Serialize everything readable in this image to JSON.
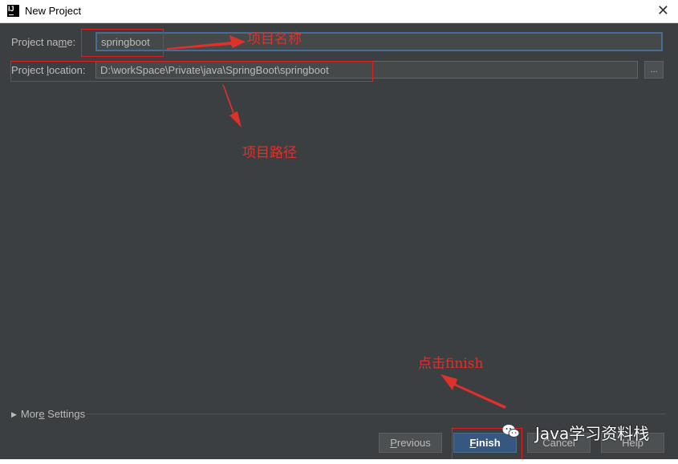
{
  "window": {
    "title": "New Project",
    "icon": "intellij-idea-icon",
    "app_icon_letters": "IJ",
    "close_glyph": "✕"
  },
  "form": {
    "name_label_pre": "Project na",
    "name_label_u": "m",
    "name_label_post": "e:",
    "name_value": "springboot",
    "location_label_pre": "Project ",
    "location_label_u": "l",
    "location_label_post": "ocation:",
    "location_value": "D:\\workSpace\\Private\\java\\SpringBoot\\springboot",
    "browse_label": "..."
  },
  "annotations": {
    "name": "项目名称",
    "location": "项目路径",
    "finish": "点击finish",
    "color": "#e0302a"
  },
  "more_settings": {
    "pre": "Mor",
    "u": "e",
    "post": " Settings"
  },
  "buttons": {
    "previous_u": "P",
    "previous_rest": "revious",
    "finish_u": "F",
    "finish_rest": "inish",
    "cancel": "Cancel",
    "help": "Help"
  },
  "watermark": {
    "text": "Java学习资料栈",
    "icon": "wechat-icon"
  },
  "colors": {
    "background": "#3c3f41",
    "accent": "#365880",
    "focus_border": "#466d94"
  }
}
